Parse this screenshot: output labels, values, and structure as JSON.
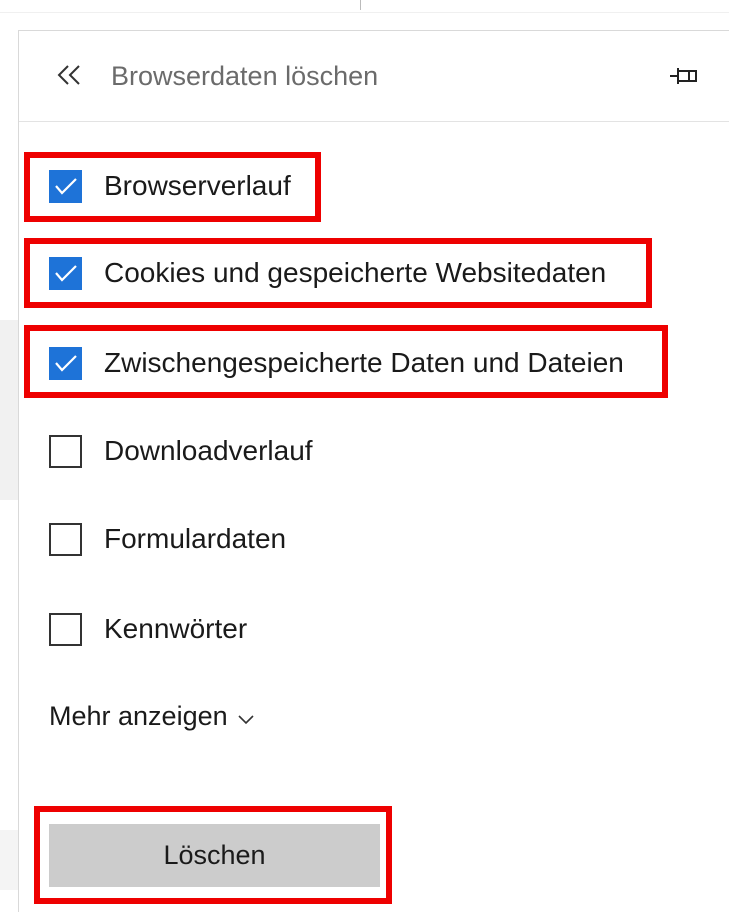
{
  "panel": {
    "title": "Browserdaten löschen",
    "back_icon": "double-chevron-left-icon",
    "pin_icon": "pin-icon"
  },
  "options": [
    {
      "label": "Browserverlauf",
      "checked": true
    },
    {
      "label": "Cookies und gespeicherte Websitedaten",
      "checked": true
    },
    {
      "label": "Zwischengespeicherte Daten und Dateien",
      "checked": true
    },
    {
      "label": "Downloadverlauf",
      "checked": false
    },
    {
      "label": "Formulardaten",
      "checked": false
    },
    {
      "label": "Kennwörter",
      "checked": false
    }
  ],
  "more": {
    "label": "Mehr anzeigen",
    "icon": "chevron-down-icon"
  },
  "actions": {
    "delete_label": "Löschen"
  },
  "colors": {
    "checkbox_checked": "#1e73d8",
    "highlight": "#ee0000",
    "button_bg": "#cccccc"
  }
}
